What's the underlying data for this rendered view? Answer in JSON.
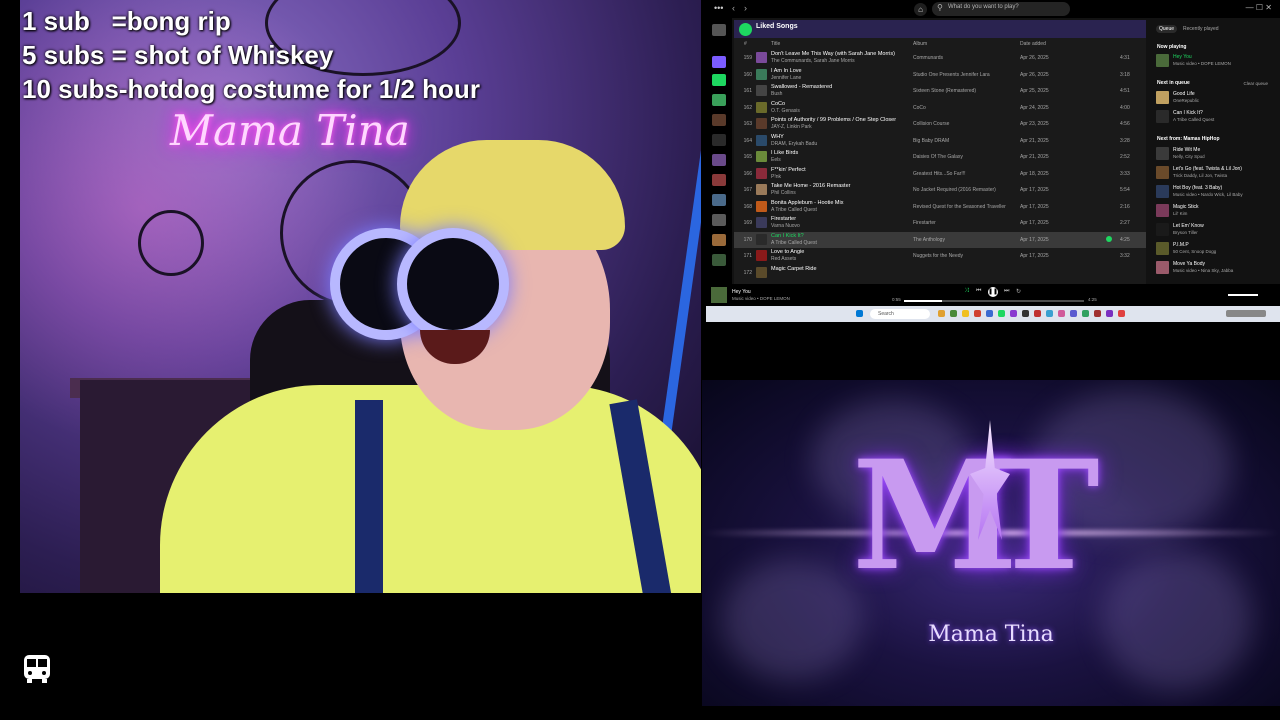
{
  "goals": {
    "line1": "1 sub   =bong rip",
    "line2": "5 subs = shot of Whiskey",
    "line3": "10 subs-hotdog costume for 1/2 hour"
  },
  "webcam": {
    "neon_sign": "Mama Tina"
  },
  "spotify": {
    "search_placeholder": "What do you want to play?",
    "playlist_title": "Liked Songs",
    "columns": {
      "number": "#",
      "title": "Title",
      "album": "Album",
      "date_added": "Date added"
    },
    "rows": [
      {
        "num": "159",
        "title": "Don't Leave Me This Way (with Sarah Jane Morris)",
        "artist": "The Communards, Sarah Jane Morris",
        "album": "Communards",
        "date": "Apr 26, 2025",
        "dur": "4:31",
        "color": "#7a4a9a"
      },
      {
        "num": "160",
        "title": "I Am In Love",
        "artist": "Jennifer Lane",
        "album": "Studio One Presents Jennifer Lara",
        "date": "Apr 26, 2025",
        "dur": "3:18",
        "color": "#3a7a5a"
      },
      {
        "num": "161",
        "title": "Swallowed - Remastered",
        "artist": "Bush",
        "album": "Sixteen Stone (Remastered)",
        "date": "Apr 25, 2025",
        "dur": "4:51",
        "color": "#444444"
      },
      {
        "num": "162",
        "title": "CoCo",
        "artist": "O.T. Genasis",
        "album": "CoCo",
        "date": "Apr 24, 2025",
        "dur": "4:00",
        "color": "#6a6a2a"
      },
      {
        "num": "163",
        "title": "Points of Authority / 99 Problems / One Step Closer",
        "artist": "JAY-Z, Linkin Park",
        "album": "Collision Course",
        "date": "Apr 23, 2025",
        "dur": "4:56",
        "color": "#5a3a2a"
      },
      {
        "num": "164",
        "title": "WHY",
        "artist": "DRAM, Erykah Badu",
        "album": "Big Baby DRAM",
        "date": "Apr 21, 2025",
        "dur": "3:28",
        "color": "#2a4a6a"
      },
      {
        "num": "165",
        "title": "I Like Birds",
        "artist": "Eels",
        "album": "Daisies Of The Galaxy",
        "date": "Apr 21, 2025",
        "dur": "2:52",
        "color": "#6a8a3a"
      },
      {
        "num": "166",
        "title": "F**kin' Perfect",
        "artist": "P!nk",
        "album": "Greatest Hits...So Far!!!",
        "date": "Apr 18, 2025",
        "dur": "3:33",
        "color": "#8a2a3a"
      },
      {
        "num": "167",
        "title": "Take Me Home - 2016 Remaster",
        "artist": "Phil Collins",
        "album": "No Jacket Required (2016 Remaster)",
        "date": "Apr 17, 2025",
        "dur": "5:54",
        "color": "#9a7a5a"
      },
      {
        "num": "168",
        "title": "Bonita Applebum - Hootie Mix",
        "artist": "A Tribe Called Quest",
        "album": "Revised Quest for the Seasoned Traveller",
        "date": "Apr 17, 2025",
        "dur": "2:16",
        "color": "#c05a1a"
      },
      {
        "num": "169",
        "title": "Firestarter",
        "artist": "Varna Nuovo",
        "album": "Firestarter",
        "date": "Apr 17, 2025",
        "dur": "2:27",
        "color": "#3a3a5a"
      },
      {
        "num": "170",
        "title": "Can I Kick It?",
        "artist": "A Tribe Called Quest",
        "album": "The Anthology",
        "date": "Apr 17, 2025",
        "dur": "4:25",
        "color": "#2a2a2a",
        "active": true
      },
      {
        "num": "171",
        "title": "Love to Angie",
        "artist": "Red Assets",
        "album": "Nuggets for the Needy",
        "date": "Apr 17, 2025",
        "dur": "3:32",
        "color": "#8a1a1a"
      },
      {
        "num": "172",
        "title": "Magic Carpet Ride",
        "artist": "",
        "album": "",
        "date": "",
        "dur": "",
        "color": "#5a4a2a"
      }
    ],
    "queue": {
      "tabs": [
        "Queue",
        "Recently played"
      ],
      "now_playing_label": "Now playing",
      "now_playing": {
        "title": "Hey You",
        "artist": "Music video • DOPE LEMON",
        "color": "#4a6a3a"
      },
      "next_in_queue_label": "Next in queue",
      "clear_label": "Clear queue",
      "next": [
        {
          "title": "Good Life",
          "artist": "OneRepublic",
          "color": "#c0a060"
        },
        {
          "title": "Can I Kick It?",
          "artist": "A Tribe Called Quest",
          "color": "#2a2a2a"
        }
      ],
      "next_from_label": "Next from: Mamas HipHop",
      "from": [
        {
          "title": "Ride Wit Me",
          "artist": "Nelly, City Spud",
          "color": "#3a3a3a"
        },
        {
          "title": "Let's Go (feat. Twista & Lil Jon)",
          "artist": "Trick Daddy, Lil Jon, Twista",
          "color": "#6a4a2a"
        },
        {
          "title": "Hot Boy (feat. 3 Baby)",
          "artist": "Music video • Nardo Wick, Lil Baby",
          "color": "#2a3a5a"
        },
        {
          "title": "Magic Stick",
          "artist": "Lil' Kim",
          "color": "#7a3a5a"
        },
        {
          "title": "Let Em' Know",
          "artist": "Bryson Tiller",
          "color": "#1a1a1a"
        },
        {
          "title": "P.I.M.P",
          "artist": "50 Cent, Snoop Dogg",
          "color": "#5a5a2a"
        },
        {
          "title": "Move Ya Body",
          "artist": "Music video • Nina Sky, Jabba",
          "color": "#9a5a6a"
        }
      ]
    },
    "player": {
      "title": "Hey You",
      "artist": "Music video • DOPE LEMON",
      "elapsed": "0:55",
      "duration": "4:25",
      "progress": 0.21
    },
    "taskbar": {
      "search_placeholder": "Search"
    }
  },
  "logo": {
    "monogram": "MT",
    "name": "Mama Tina"
  },
  "colors": {
    "spotify_green": "#1ed760",
    "neon_pink": "#ff5df0",
    "logo_purple": "#c89af0"
  }
}
